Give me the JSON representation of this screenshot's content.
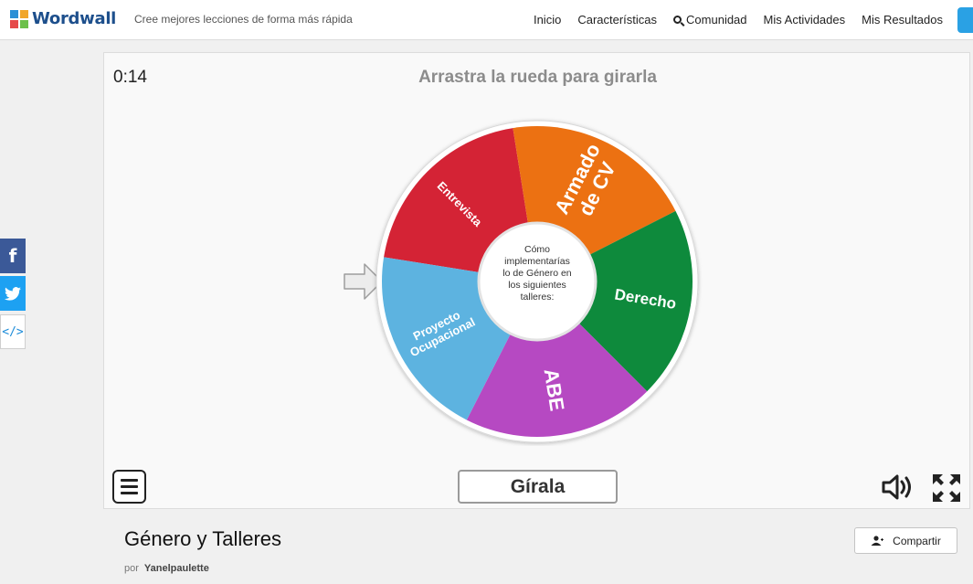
{
  "header": {
    "brand": "Wordwall",
    "tagline": "Cree mejores lecciones de forma más rápida",
    "nav": [
      "Inicio",
      "Características",
      "Comunidad",
      "Mis Actividades",
      "Mis Resultados"
    ]
  },
  "share_sidebar": {
    "facebook_glyph": "f",
    "embed_glyph": "</>"
  },
  "activity": {
    "timer": "0:14",
    "instruction": "Arrastra la rueda para girarla",
    "center_text": [
      "Cómo",
      "implementarías",
      "lo de Género en",
      "los siguientes",
      "talleres:"
    ],
    "segments": [
      {
        "label": [
          "Entrevista"
        ],
        "color": "#d42335"
      },
      {
        "label": [
          "Armado",
          "de CV"
        ],
        "color": "#ec7112"
      },
      {
        "label": [
          "Derecho"
        ],
        "color": "#0e8a3c"
      },
      {
        "label": [
          "ABE"
        ],
        "color": "#b649c2"
      },
      {
        "label": [
          "Proyecto",
          "Ocupacional"
        ],
        "color": "#5db3e0"
      }
    ],
    "spin_button": "Gírala"
  },
  "info": {
    "title": "Género y Talleres",
    "by_label": "por",
    "author": "Yanelpaulette",
    "share_label": "Compartir"
  },
  "icons": [
    "logo-icon",
    "search-icon",
    "facebook-icon",
    "twitter-icon",
    "embed-icon",
    "pointer-arrow-icon",
    "menu-icon",
    "sound-icon",
    "fullscreen-icon",
    "person-icon"
  ]
}
